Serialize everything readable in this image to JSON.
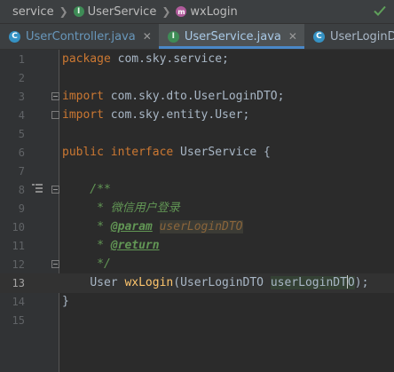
{
  "breadcrumb": {
    "items": [
      "service",
      "UserService",
      "wxLogin"
    ],
    "icon_letters": {
      "class": "I",
      "method": "m"
    }
  },
  "tabs": [
    {
      "label": "UserController.java",
      "icon": "C"
    },
    {
      "label": "UserService.java",
      "icon": "I",
      "active": true
    },
    {
      "label": "UserLoginDTO.java",
      "icon": "C"
    }
  ],
  "editor": {
    "current_line": 13,
    "line_numbers": [
      "1",
      "2",
      "3",
      "4",
      "5",
      "6",
      "7",
      "8",
      "9",
      "10",
      "11",
      "12",
      "13",
      "14",
      "15"
    ],
    "code": {
      "l1_kw": "package",
      "l1_rest": " com.sky.service;",
      "l3_kw": "import",
      "l3_rest": " com.sky.dto.UserLoginDTO;",
      "l4_kw": "import",
      "l4_rest": " com.sky.entity.User;",
      "l6_kw": "public interface",
      "l6_rest": " UserService {",
      "l8_comment": "    /**",
      "l9_comment": "     * 微信用户登录",
      "l10_prefix": "     * ",
      "l10_tag": "@param",
      "l10_param": "userLoginDTO",
      "l11_prefix": "     * ",
      "l11_tag": "@return",
      "l12_comment": "     */",
      "l13_indent": "    ",
      "l13_type": "User",
      "l13_method": "wxLogin",
      "l13_args": "(UserLoginDTO ",
      "l13_param_a": "userLoginDT",
      "l13_param_b": "O",
      "l13_end": ");",
      "l14": "}"
    }
  },
  "colors": {
    "keyword": "#cc7832",
    "method": "#ffc66d",
    "comment": "#629755",
    "text": "#a9b7c6",
    "tab_underline": "#4a88c7"
  },
  "icons": [
    "class-icon",
    "interface-icon",
    "method-icon",
    "close-icon",
    "check-icon",
    "implemented-gutter-icon",
    "fold-icon"
  ]
}
